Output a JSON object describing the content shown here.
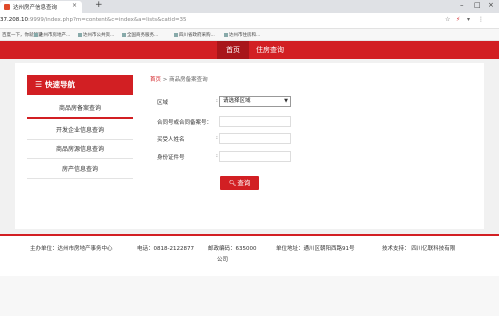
{
  "browser": {
    "tab_title": "达州房产信息查询",
    "tab_close": "×",
    "new_tab": "+",
    "window_controls": [
      "–",
      "□",
      "×"
    ],
    "url_host": "37.208.10",
    "url_rest": ":9999/index.php?m=content&c=index&a=lists&catid=35",
    "address_icons": [
      "☆",
      "⚡",
      "▾",
      "⋮"
    ],
    "bookmarks": [
      "百度一下，你就知道",
      "达州市房地产...",
      "达州市公共资...",
      "全国商务服务...",
      "四川省政府采购...",
      "达州市住房和..."
    ]
  },
  "nav": {
    "home": "首页",
    "house_query": "住房查询"
  },
  "sidebar": {
    "title": "快速导航",
    "icon": "list-icon",
    "items": [
      "商品房备案查询",
      "开发企业信息查询",
      "商品房源信息查询",
      "房产信息查询"
    ]
  },
  "breadcrumb": {
    "home": "首页",
    "separator": ">",
    "current": "商品房备案查询"
  },
  "form": {
    "region_label": "区域",
    "region_value": "请选择区域",
    "contract_label": "合同号或合同备案号：",
    "buyer_label": "买受人姓名",
    "idcard_label": "身份证件号",
    "colon": ":",
    "submit": "查询"
  },
  "footer": {
    "sponsor": "主办单位：达州市房地产事务中心",
    "phone": "电话：0818-2122877",
    "postcode": "邮政编码：635000",
    "address": "单位地址：通川区朝阳西路91号",
    "support": "技术支持： 四川亿联科技有限",
    "support_cont": "公司"
  },
  "colors": {
    "brand_red": "#d21f23",
    "nav_active": "#a8161a",
    "page_bg": "#f1f1f1"
  }
}
